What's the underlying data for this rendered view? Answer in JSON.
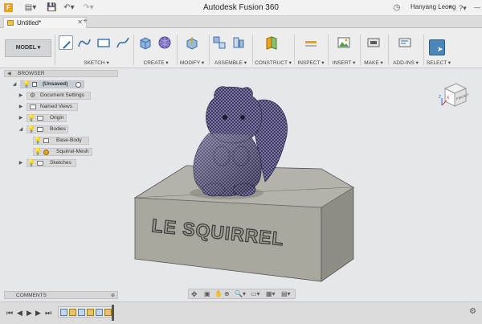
{
  "app": {
    "title": "Autodesk Fusion 360"
  },
  "user": {
    "name": "Hanyang Leong"
  },
  "document": {
    "tab_label": "Untitled*"
  },
  "ribbon": {
    "workspace": "MODEL",
    "groups": [
      "SKETCH",
      "CREATE",
      "MODIFY",
      "ASSEMBLE",
      "CONSTRUCT",
      "INSPECT",
      "INSERT",
      "MAKE",
      "ADD-INS",
      "SELECT"
    ]
  },
  "browser": {
    "title": "BROWSER",
    "root": "(Unsaved)",
    "items": [
      "Document Settings",
      "Named Views",
      "Origin",
      "Bodies",
      "Base-Body",
      "Squirrel-Mesh",
      "Sketches"
    ]
  },
  "comments": {
    "title": "COMMENTS"
  },
  "model": {
    "label": "LE SQUIRREL"
  },
  "viewcube": {
    "face": "FRONT",
    "axis_x": "X",
    "axis_z": "Z"
  },
  "colors": {
    "accent": "#e8a21c",
    "select": "#4c86b8",
    "base_body": "#b4b3ab",
    "mesh": "#3b3864"
  },
  "icons": [
    "app-menu-icon",
    "file-icon",
    "save-icon",
    "undo-icon",
    "redo-icon",
    "help-icon",
    "clock-icon",
    "gear-icon",
    "eye-icon",
    "folder-icon",
    "play-icon"
  ]
}
